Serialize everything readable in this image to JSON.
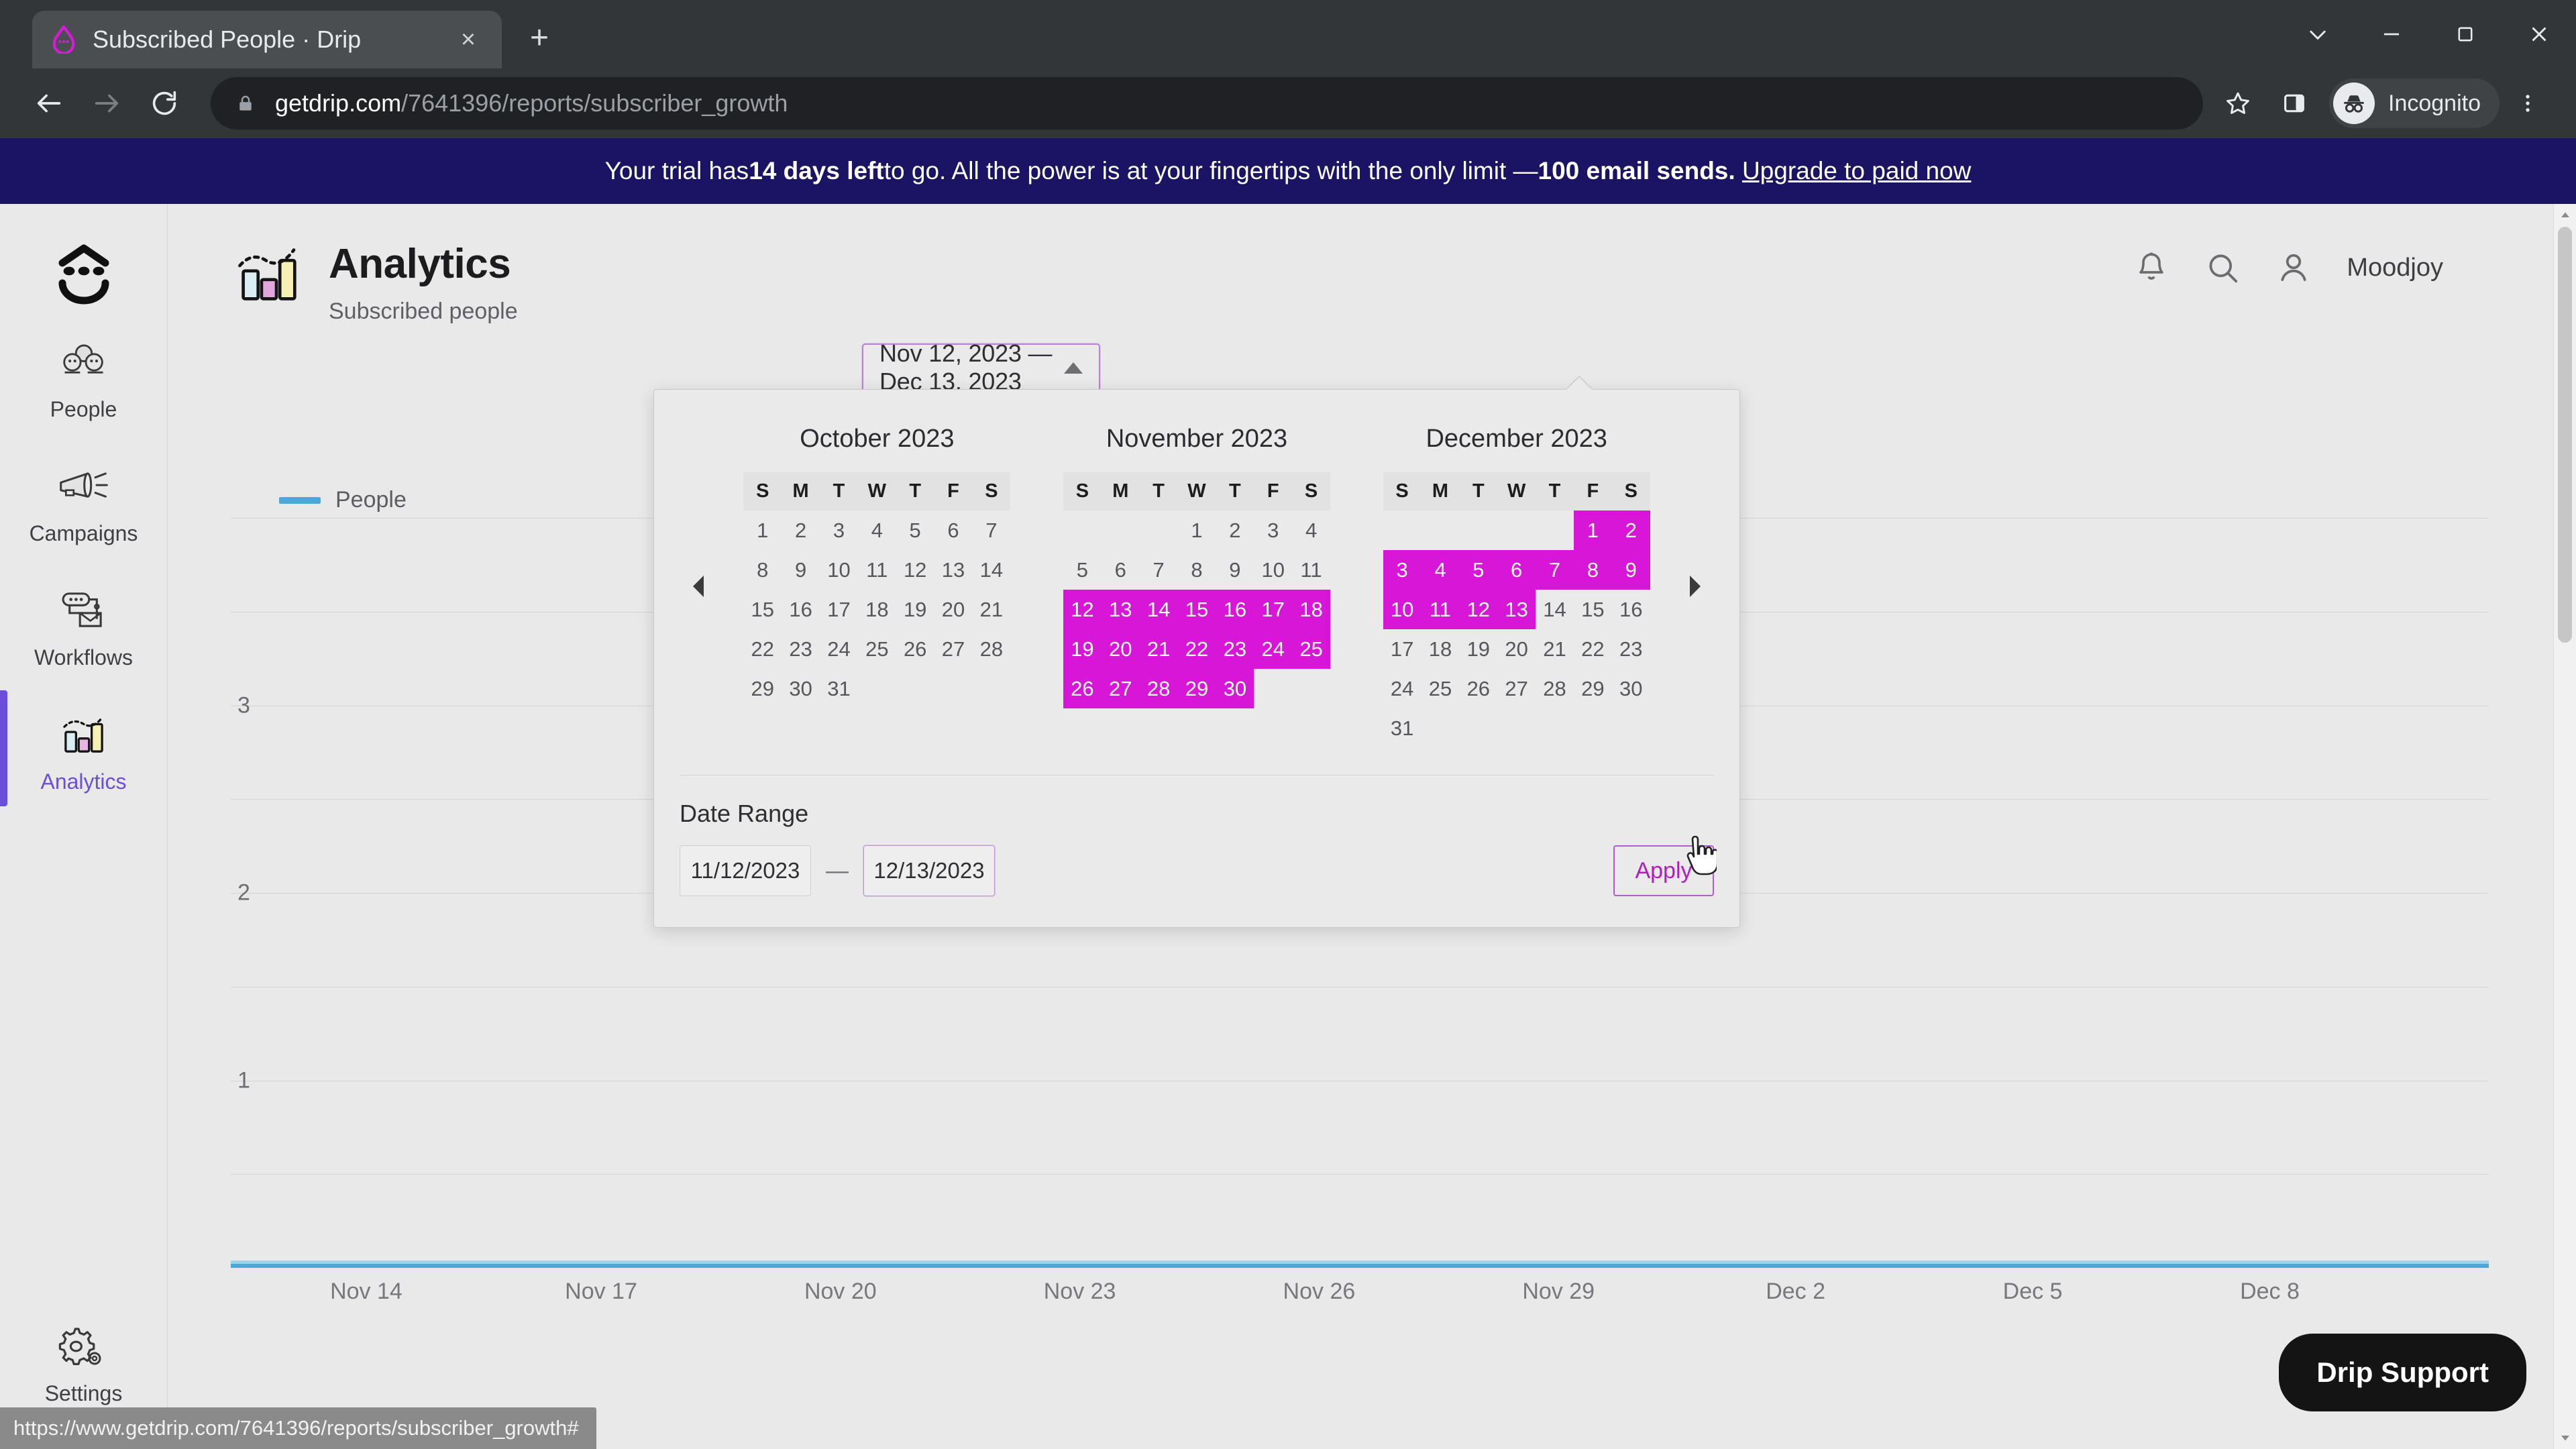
{
  "browser": {
    "tab_title": "Subscribed People · Drip",
    "tab_favicon": "drip-logo-icon",
    "close_tab": "×",
    "new_tab": "+",
    "url_domain": "getdrip.com",
    "url_path": "/7641396/reports/subscriber_growth",
    "profile_label": "Incognito",
    "status_url": "https://www.getdrip.com/7641396/reports/subscriber_growth#"
  },
  "banner": {
    "prefix": "Your trial has ",
    "days_left": "14 days left",
    "middle": " to go. All the power is at your fingertips with the only limit — ",
    "limit": "100 email sends.",
    "link": "Upgrade to paid now",
    "bg_color": "#1b1464"
  },
  "sidebar": {
    "brand": "drip-face-logo",
    "items": [
      {
        "label": "People",
        "icon": "people-icon",
        "active": false
      },
      {
        "label": "Campaigns",
        "icon": "megaphone-icon",
        "active": false
      },
      {
        "label": "Workflows",
        "icon": "workflow-icon",
        "active": false
      },
      {
        "label": "Analytics",
        "icon": "bar-chart-icon",
        "active": true
      }
    ],
    "bottom": {
      "label": "Settings",
      "icon": "gear-icon"
    },
    "active_color": "#6c4fd8"
  },
  "header": {
    "icon": "analytics-bar-chart-icon",
    "title": "Analytics",
    "subtitle": "Subscribed people",
    "bell": "bell-icon",
    "search": "search-icon",
    "avatar": "user-avatar-icon",
    "user": "Moodjoy"
  },
  "date_trigger": {
    "label": "Nov 12, 2023 — Dec 13, 2023",
    "caret": "caret-up-icon",
    "border_color": "#b983d4"
  },
  "calendar": {
    "prev_arrow": "chevron-left-icon",
    "next_arrow": "chevron-right-icon",
    "dow": [
      "S",
      "M",
      "T",
      "W",
      "T",
      "F",
      "S"
    ],
    "selected_color": "#d816d8",
    "months": [
      {
        "title": "October 2023",
        "lead_blank": 0,
        "days": 31,
        "selected": []
      },
      {
        "title": "November 2023",
        "lead_blank": 3,
        "days": 30,
        "selected": [
          12,
          13,
          14,
          15,
          16,
          17,
          18,
          19,
          20,
          21,
          22,
          23,
          24,
          25,
          26,
          27,
          28,
          29,
          30
        ]
      },
      {
        "title": "December 2023",
        "lead_blank": 5,
        "days": 31,
        "selected": [
          1,
          2,
          3,
          4,
          5,
          6,
          7,
          8,
          9,
          10,
          11,
          12,
          13
        ]
      }
    ],
    "footer": {
      "label": "Date Range",
      "start_value": "11/12/2023",
      "start_placeholder": "mm/dd/yyyy",
      "dash": "—",
      "end_value": "12/13/2023",
      "end_placeholder": "mm/dd/yyyy",
      "apply_label": "Apply"
    }
  },
  "chart_data": {
    "type": "line",
    "title": "",
    "xlabel": "",
    "ylabel": "",
    "legend": [
      {
        "name": "People",
        "color": "#4aa9d8"
      }
    ],
    "legend_position": "top-left",
    "grid": true,
    "yticks": [
      1,
      2,
      3
    ],
    "ylim": [
      0,
      4
    ],
    "x": [
      "Nov 14",
      "Nov 17",
      "Nov 20",
      "Nov 23",
      "Nov 26",
      "Nov 29",
      "Dec 2",
      "Dec 5",
      "Dec 8"
    ],
    "series": [
      {
        "name": "People",
        "values": [
          0,
          0,
          0,
          0,
          0,
          0,
          0,
          0,
          0
        ]
      }
    ]
  },
  "support": {
    "label": "Drip Support"
  }
}
